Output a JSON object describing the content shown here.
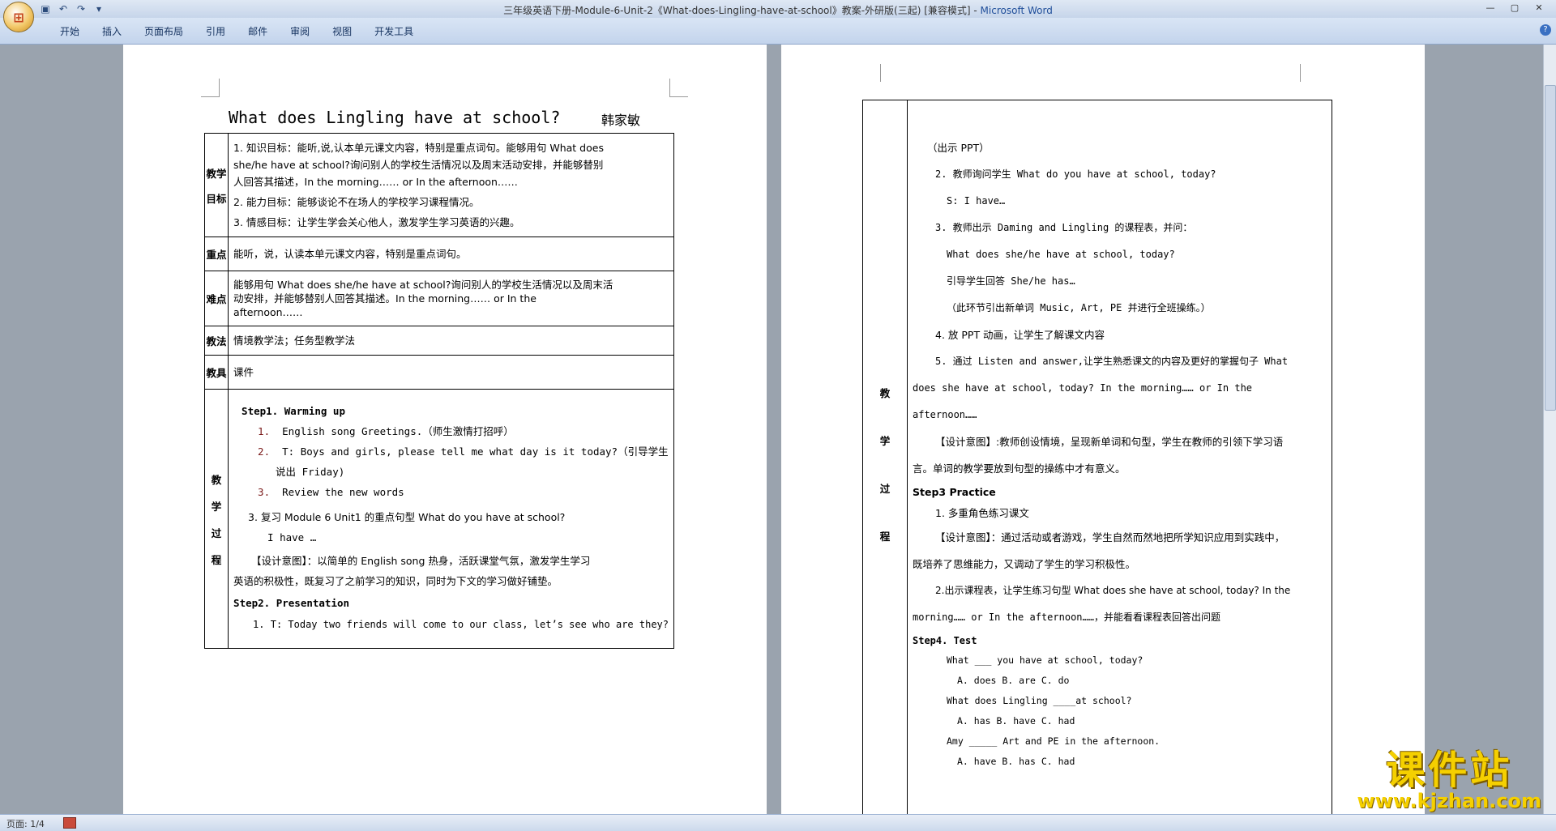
{
  "window": {
    "title_doc": "三年级英语下册-Module-6-Unit-2《What-does-Lingling-have-at-school》教案-外研版(三起) [兼容模式] - ",
    "title_app": "Microsoft Word"
  },
  "ribbon": {
    "tabs": [
      "开始",
      "插入",
      "页面布局",
      "引用",
      "邮件",
      "审阅",
      "视图",
      "开发工具"
    ]
  },
  "status": {
    "page": "页面: 1/4"
  },
  "doc": {
    "title": "What does Lingling have at school?",
    "author": "韩家敏",
    "rows": {
      "goals": {
        "label": [
          "教学",
          "目标"
        ],
        "lines": [
          "1. 知识目标：能听,说,认本单元课文内容，特别是重点词句。能够用句 What does",
          "she/he have at school?询问别人的学校生活情况以及周末活动安排，并能够替别",
          "人回答其描述，In the morning…… or In the afternoon……",
          "2. 能力目标：能够谈论不在场人的学校学习课程情况。",
          "3. 情感目标：让学生学会关心他人，激发学生学习英语的兴趣。"
        ]
      },
      "key": {
        "label": "重点",
        "text": "能听，说，认读本单元课文内容，特别是重点词句。"
      },
      "difficult": {
        "label": "难点",
        "lines": [
          "能够用句 What does she/he have at school?询问别人的学校生活情况以及周末活",
          "动安排，并能够替别人回答其描述。In the morning…… or In the",
          "afternoon……"
        ]
      },
      "method": {
        "label": "教法",
        "text": "情境教学法；任务型教学法"
      },
      "tools": {
        "label": "教具",
        "text": "课件"
      },
      "process": {
        "label": [
          "教",
          "学",
          "过",
          "程"
        ],
        "step1": "Step1. Warming up",
        "step1_items": [
          "English song  Greetings.（师生激情打招呼）",
          "T: Boys and girls, please tell me what day is it today?（引导学生",
          "说出 Friday)",
          "Review the new words"
        ],
        "item3": "3. 复习 Module 6 Unit1 的重点句型 What do you have at school?",
        "ihave": "I have …",
        "design1a": "【设计意图】：以简单的 English song 热身，活跃课堂气氛，激发学生学习",
        "design1b": "英语的积极性，既复习了之前学习的知识，同时为下文的学习做好铺垫。",
        "step2": "Step2. Presentation",
        "p1": "1. T: Today two friends will come to our class, let’s see who are they?"
      }
    },
    "page2": {
      "label": [
        "教",
        "学",
        "过",
        "程"
      ],
      "lines": [
        "（出示 PPT）",
        "2. 教师询问学生 What do you have at school, today?",
        "S: I have…",
        "3. 教师出示 Daming and Lingling 的课程表，并问：",
        "What does she/he have at school, today?",
        "引导学生回答 She/he has…",
        "（此环节引出新单词 Music, Art, PE 并进行全班操练。）",
        "4. 放 PPT 动画，让学生了解课文内容",
        "5. 通过 Listen and answer,让学生熟悉课文的内容及更好的掌握句子 What",
        "does she have at school, today? In the morning…… or In the",
        "afternoon……",
        "【设计意图】:教师创设情境，呈现新单词和句型，学生在教师的引领下学习语",
        "言。单词的教学要放到句型的操练中才有意义。",
        "Step3 Practice",
        "1. 多重角色练习课文",
        "【设计意图】：通过活动或者游戏，学生自然而然地把所学知识应用到实践中，",
        "既培养了思维能力，又调动了学生的学习积极性。",
        "2.出示课程表，让学生练习句型 What does she have at school, today? In the",
        "morning…… or In the afternoon……，并能看看课程表回答出问题",
        "Step4. Test",
        "What ___ you have at school, today?",
        "A. does    B. are    C. do",
        "What does Lingling ____at school?",
        "A. has     B. have    C. had",
        "Amy _____ Art and PE in the afternoon.",
        "A. have    B. has    C. had"
      ]
    }
  },
  "watermark": {
    "text": "课件站",
    "url": "www.kjzhan.com"
  }
}
